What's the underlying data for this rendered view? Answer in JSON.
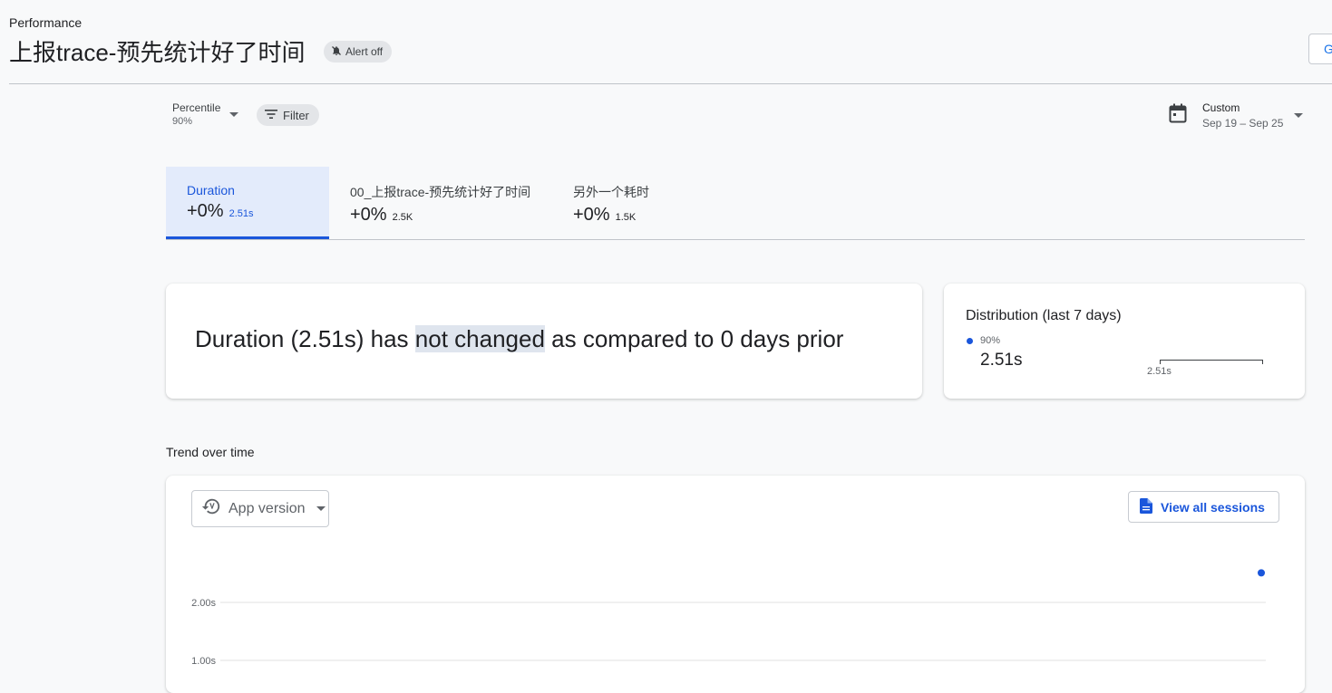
{
  "header": {
    "breadcrumb": "Performance",
    "title": "上报trace-预先统计好了时间",
    "alert_chip": "Alert off",
    "top_right_button": "G"
  },
  "filters": {
    "percentile_label": "Percentile",
    "percentile_value": "90%",
    "filter_label": "Filter",
    "date_label": "Custom",
    "date_value": "Sep 19 – Sep 25"
  },
  "tabs": [
    {
      "name": "Duration",
      "change": "+0%",
      "value": "2.51s",
      "active": true
    },
    {
      "name": "00_上报trace-预先统计好了时间",
      "change": "+0%",
      "value": "2.5K",
      "active": false
    },
    {
      "name": "另外一个耗时",
      "change": "+0%",
      "value": "1.5K",
      "active": false
    }
  ],
  "summary": {
    "before": "Duration (2.51s) has ",
    "highlight": "not changed",
    "after": " as compared to 0 days prior"
  },
  "distribution": {
    "title": "Distribution (last 7 days)",
    "percentile": "90%",
    "value": "2.51s",
    "axis_label": "2.51s"
  },
  "trend": {
    "title": "Trend over time",
    "group_by": "App version",
    "view_sessions": "View all sessions"
  },
  "colors": {
    "accent": "#1a56db",
    "background": "#f8f9fa",
    "active_tab_bg": "#e3ebfb",
    "highlight_bg": "#dfe5ee"
  },
  "icons": {
    "alert": "bell-off-icon",
    "filter": "filter-icon",
    "calendar": "calendar-icon",
    "history": "history-icon",
    "sessions": "document-icon"
  },
  "chart_data": {
    "type": "scatter",
    "title": "",
    "xlabel": "",
    "ylabel": "",
    "y_ticks": [
      "2.00s",
      "1.00s"
    ],
    "y_tick_values": [
      2.0,
      1.0
    ],
    "series": [
      {
        "values": [
          2.51
        ]
      }
    ],
    "grid": true
  }
}
